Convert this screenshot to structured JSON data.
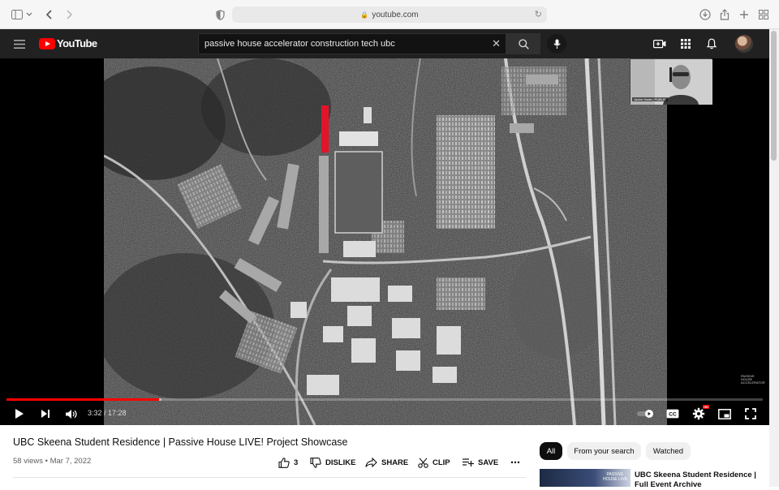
{
  "browser": {
    "url": "youtube.com",
    "icons": [
      "sidebar-icon",
      "chevron-down-icon",
      "back-icon",
      "forward-icon",
      "shield-icon",
      "lock-icon",
      "reload-icon",
      "download-icon",
      "share-icon",
      "new-tab-icon",
      "tab-overview-icon"
    ]
  },
  "youtube_header": {
    "logo_text": "YouTube",
    "search_value": "passive house accelerator construction tech ubc",
    "icons": [
      "hamburger-icon",
      "youtube-logo-icon",
      "clear-icon",
      "search-icon",
      "mic-icon",
      "create-icon",
      "apps-icon",
      "bell-icon",
      "avatar"
    ]
  },
  "player": {
    "webcam_label": "Jackie Harte | PUBLIC",
    "watermark": "PASSIVE HOUSE ACCELERATOR",
    "time_display": "3:32 / 17:28",
    "progress_fraction": 0.202,
    "buffer_fraction": 0.205,
    "settings_badge": "HD",
    "accent_color": "#ff0000",
    "controls": [
      "play-icon",
      "next-icon",
      "volume-icon",
      "autoplay-toggle",
      "cc-icon",
      "settings-icon",
      "miniplayer-icon",
      "fullscreen-icon"
    ]
  },
  "video": {
    "title": "UBC Skeena Student Residence | Passive House LIVE! Project Showcase",
    "meta": "58 views • Mar 7, 2022",
    "actions": {
      "like_count": "3",
      "dislike": "DISLIKE",
      "share": "SHARE",
      "clip": "CLIP",
      "save": "SAVE",
      "more": "⋯"
    }
  },
  "sidebar": {
    "chips": [
      "All",
      "From your search",
      "Watched"
    ],
    "recommendation": {
      "title": "UBC Skeena Student Residence | Full Event Archive",
      "thumb_text": "PASSIVE HOUSE LIVE"
    }
  }
}
